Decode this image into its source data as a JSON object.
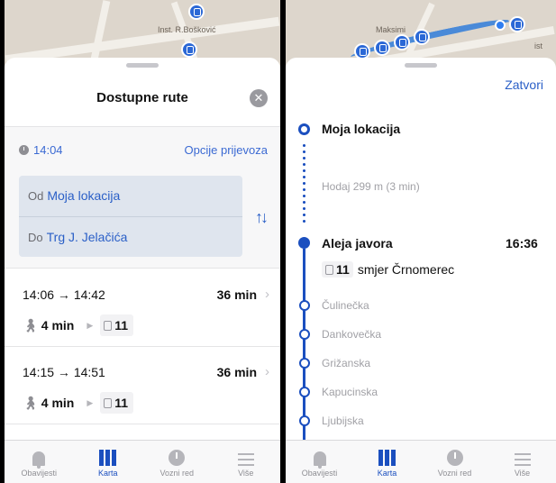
{
  "left": {
    "map": {
      "label": "Inst. R.Bošković"
    },
    "sheet": {
      "title": "Dostupne rute",
      "close_glyph": "✕",
      "time": "14:04",
      "options_label": "Opcije prijevoza",
      "from_prefix": "Od",
      "from_value": "Moja lokacija",
      "to_prefix": "Do",
      "to_value": "Trg J. Jelačića",
      "swap_glyph": "↑↓",
      "routes": [
        {
          "times": "14:06 → 14:42",
          "duration": "36 min",
          "walk": "4 min",
          "line": "11"
        },
        {
          "times": "14:15 → 14:51",
          "duration": "36 min",
          "walk": "4 min",
          "line": "11"
        }
      ]
    }
  },
  "right": {
    "map": {
      "label_1": "Maksimi",
      "label_2": "ist"
    },
    "sheet": {
      "close_label": "Zatvori",
      "origin": "Moja lokacija",
      "walk_info": "Hodaj 299 m (3 min)",
      "board_stop": "Aleja javora",
      "board_time": "16:36",
      "line": "11",
      "direction": "smjer Črnomerec",
      "stops": [
        "Čulinečka",
        "Dankovečka",
        "Grižanska",
        "Kapucinska",
        "Ljubijska"
      ]
    }
  },
  "tabbar": {
    "tabs": [
      {
        "label": "Obavijesti",
        "icon": "bell-icon"
      },
      {
        "label": "Karta",
        "icon": "map-icon"
      },
      {
        "label": "Vozni red",
        "icon": "clock-icon"
      },
      {
        "label": "Više",
        "icon": "menu-icon"
      }
    ],
    "active": "Karta"
  },
  "colors": {
    "accent": "#1b4fbf",
    "link": "#2a5fc7",
    "muted": "#8e8e93"
  }
}
